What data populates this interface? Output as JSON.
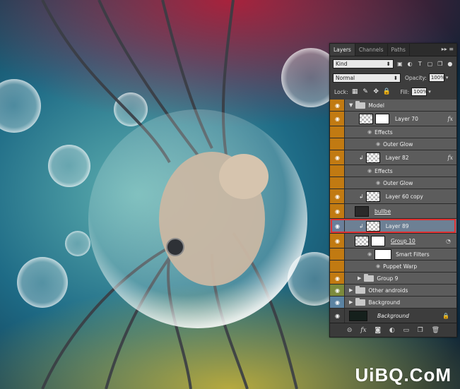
{
  "panel": {
    "tabs": [
      "Layers",
      "Channels",
      "Paths"
    ],
    "menu_glyph": "▸▸ ≡",
    "filter": {
      "kind_label": "Kind"
    },
    "blend": {
      "mode": "Normal",
      "opacity_label": "Opacity:",
      "opacity": "100%"
    },
    "lock": {
      "label": "Lock:",
      "fill_label": "Fill:",
      "fill": "100%"
    }
  },
  "layers": [
    {
      "label": "Model",
      "type": "group",
      "color": "#c17a12"
    },
    {
      "label": "Layer 70",
      "type": "layer",
      "color": "#c17a12",
      "fx": "fx"
    },
    {
      "label": "Effects",
      "type": "sub",
      "color": "#c17a12"
    },
    {
      "label": "Outer Glow",
      "type": "sub2",
      "color": "#c17a12"
    },
    {
      "label": "Layer 82",
      "type": "layer",
      "color": "#c17a12",
      "fx": "fx"
    },
    {
      "label": "Effects",
      "type": "sub",
      "color": "#c17a12"
    },
    {
      "label": "Outer Glow",
      "type": "sub2",
      "color": "#c17a12"
    },
    {
      "label": "Layer 60 copy",
      "type": "layer",
      "color": "#c17a12"
    },
    {
      "label": "bullbe",
      "type": "layer",
      "color": "#c17a12"
    },
    {
      "label": "Layer 89",
      "type": "layer",
      "color": "#6a7f9a",
      "selected": true
    },
    {
      "label": "Group 10",
      "type": "layer",
      "color": "#c17a12"
    },
    {
      "label": "Smart Filters",
      "type": "sub",
      "color": "#c17a12"
    },
    {
      "label": "Puppet Warp",
      "type": "sub2",
      "color": "#c17a12"
    },
    {
      "label": "Group 9",
      "type": "group",
      "color": "#c17a12"
    },
    {
      "label": "Other androids",
      "type": "group",
      "color": "#7c8a3c"
    },
    {
      "label": "Background",
      "type": "group",
      "color": "#5b83a2"
    },
    {
      "label": "Background",
      "type": "bg",
      "color": "#3d3d3d"
    }
  ],
  "footer_icons": [
    "link-icon",
    "fx-icon",
    "mask-icon",
    "adjustment-icon",
    "folder-icon",
    "new-layer-icon",
    "trash-icon"
  ],
  "footer_glyphs": [
    "⊝",
    "fx",
    "◙",
    "◐",
    "▭",
    "❐",
    "🗑"
  ],
  "watermark": "UiBQ.CoM",
  "colors": {
    "accent_orange": "#c17a12",
    "selection_outline": "#e03232",
    "panel_bg": "#3d3d3d"
  }
}
